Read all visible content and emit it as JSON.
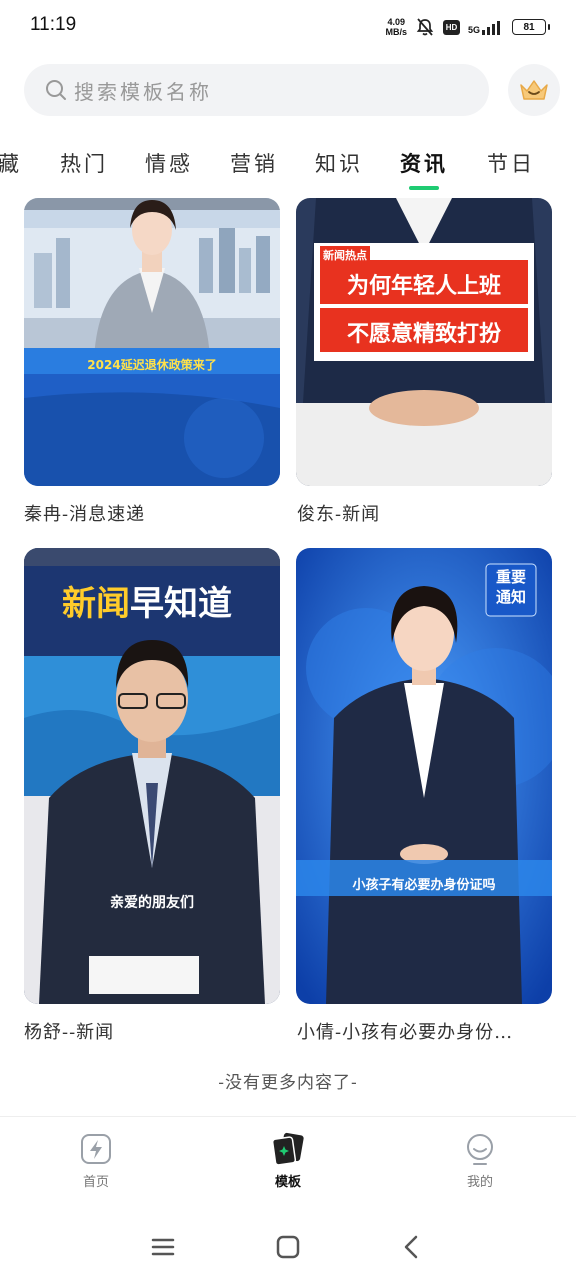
{
  "status_bar": {
    "time": "11:19",
    "net_speed_value": "4.09",
    "net_speed_unit": "MB/s",
    "hd": "HD",
    "network": "5G",
    "battery": "81"
  },
  "search": {
    "placeholder": "搜索模板名称"
  },
  "tabs": [
    {
      "label": "藏"
    },
    {
      "label": "热门"
    },
    {
      "label": "情感"
    },
    {
      "label": "营销"
    },
    {
      "label": "知识"
    },
    {
      "label": "资讯",
      "active": true
    },
    {
      "label": "节日"
    }
  ],
  "cards": [
    {
      "title": "秦冉-消息速递",
      "overlay": "2024延迟退休政策来了"
    },
    {
      "title": "俊东-新闻",
      "overlay_tag": "新闻热点",
      "overlay_line1": "为何年轻人上班",
      "overlay_line2": "不愿意精致打扮"
    },
    {
      "title": "杨舒--新闻",
      "overlay_head_a": "新闻",
      "overlay_head_b": "早知道",
      "overlay_sub": "亲爱的朋友们"
    },
    {
      "title": "小倩-小孩有必要办身份…",
      "overlay_badge_1": "重要",
      "overlay_badge_2": "通知",
      "overlay_sub": "小孩子有必要办身份证吗"
    }
  ],
  "end_text": "-没有更多内容了-",
  "bottom_nav": {
    "items": [
      {
        "label": "首页",
        "icon": "lightning-icon"
      },
      {
        "label": "模板",
        "icon": "templates-icon",
        "active": true
      },
      {
        "label": "我的",
        "icon": "profile-icon"
      }
    ]
  },
  "colors": {
    "accent": "#1fcb72",
    "overlay_red": "#e8321f"
  }
}
